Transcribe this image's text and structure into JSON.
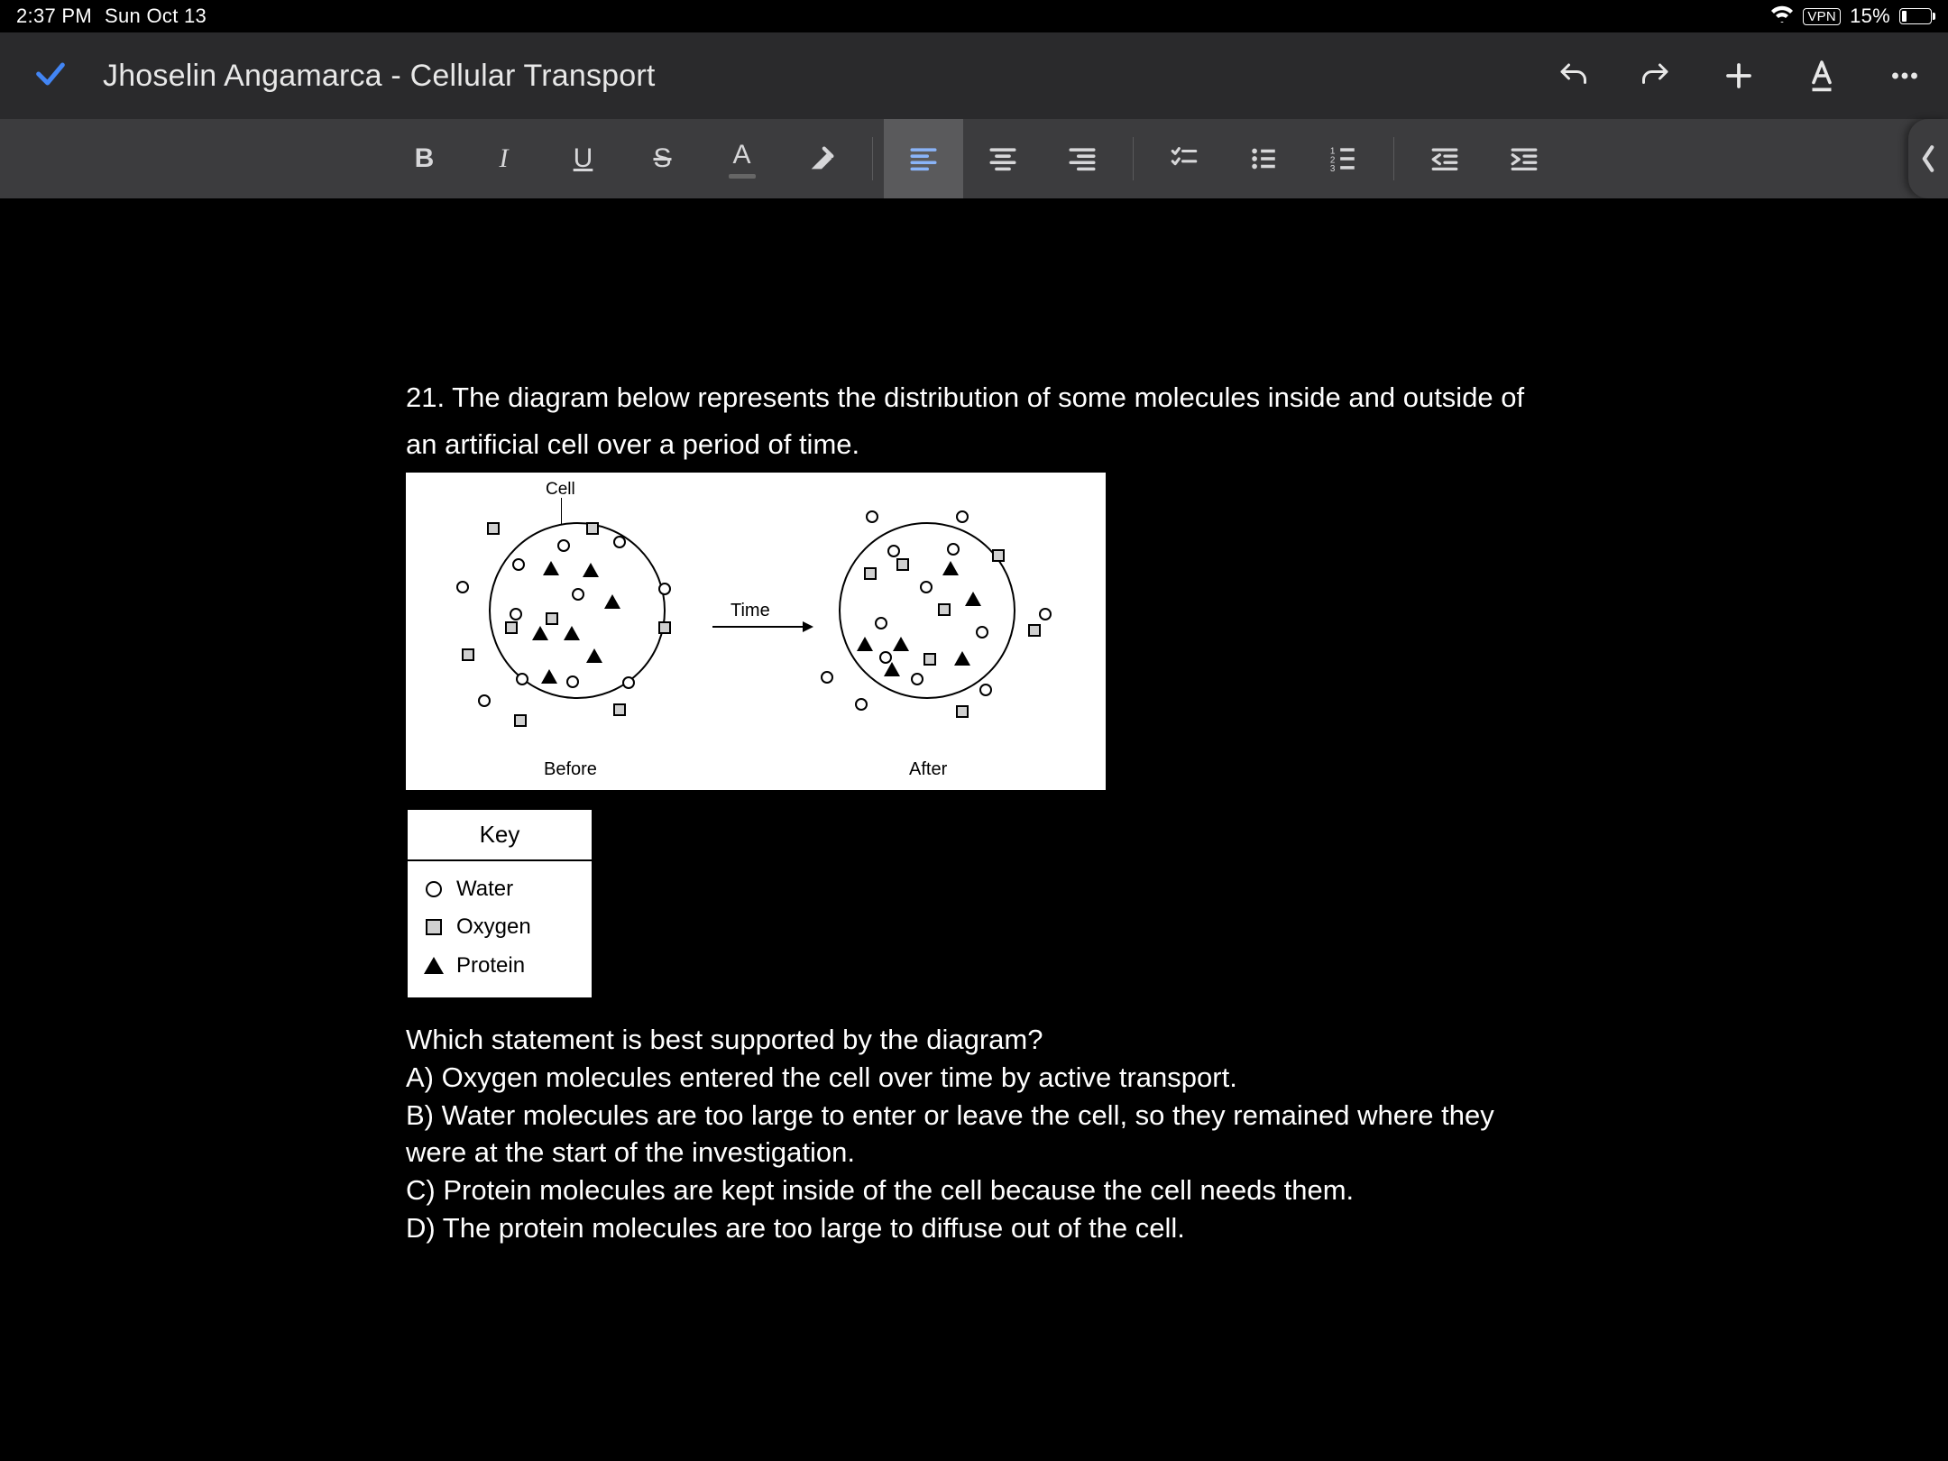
{
  "status": {
    "time": "2:37 PM",
    "date": "Sun Oct 13",
    "vpn": "VPN",
    "battery_text": "15%"
  },
  "header": {
    "title": "Jhoselin Angamarca - Cellular Transport"
  },
  "toolbar": {
    "bold": "B",
    "italic": "I",
    "underline": "U",
    "strike": "S",
    "textcolor": "A"
  },
  "question": {
    "prompt_line1": "21. The diagram below represents the distribution of some molecules inside and outside of",
    "prompt_line2": "an artificial cell over a period of time.",
    "diagram": {
      "cell_label": "Cell",
      "time_label": "Time",
      "before_label": "Before",
      "after_label": "After"
    },
    "key": {
      "title": "Key",
      "items": [
        {
          "shape": "circle",
          "label": "Water"
        },
        {
          "shape": "square",
          "label": "Oxygen"
        },
        {
          "shape": "triangle",
          "label": "Protein"
        }
      ]
    },
    "stem": "Which statement is best supported by the diagram?",
    "choices": {
      "A": "A) Oxygen molecules entered the cell over time by active transport.",
      "B1": "B) Water molecules are too large to enter or leave the cell, so they remained where they",
      "B2": "were at the start of the investigation.",
      "C": "C) Protein molecules are kept inside of the cell because the cell needs them.",
      "D": "D) The protein molecules are too large to diffuse out of the cell."
    }
  }
}
